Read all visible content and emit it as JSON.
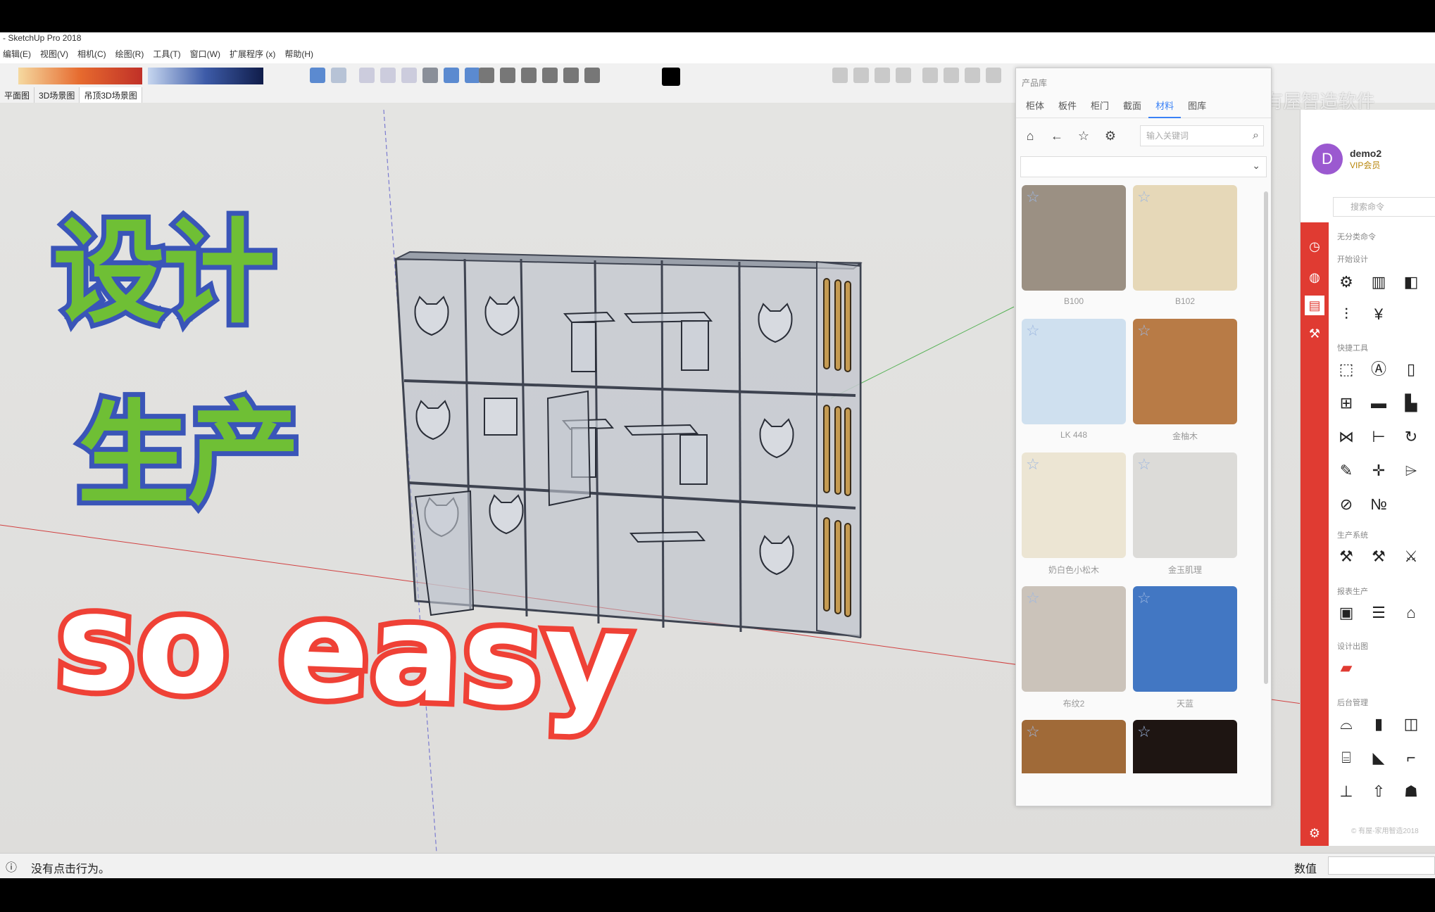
{
  "window": {
    "title": "- SketchUp Pro 2018"
  },
  "menu": [
    "编辑(E)",
    "视图(V)",
    "相机(C)",
    "绘图(R)",
    "工具(T)",
    "窗口(W)",
    "扩展程序 (x)",
    "帮助(H)"
  ],
  "scene_tabs": [
    "平面图",
    "3D场景图",
    "吊顶3D场景图"
  ],
  "overlay": {
    "line1": "设计",
    "line2": "生产",
    "line3": "so easy"
  },
  "watermark": "@有屋智造软件",
  "library": {
    "title": "产品库",
    "tabs": [
      "柜体",
      "板件",
      "柜门",
      "截面",
      "材料",
      "图库"
    ],
    "active_tab": "材料",
    "search_placeholder": "输入关键词",
    "materials": [
      {
        "name": "B100",
        "color": "#9b9083"
      },
      {
        "name": "B102",
        "color": "#e6d8b8"
      },
      {
        "name": "LK 448",
        "color": "#cfe0ef"
      },
      {
        "name": "金柚木",
        "color": "#b87b46"
      },
      {
        "name": "奶白色小松木",
        "color": "#ece5d3"
      },
      {
        "name": "金玉肌理",
        "color": "#dcdbd8"
      },
      {
        "name": "布纹2",
        "color": "#cbc3ba"
      },
      {
        "name": "天蓝",
        "color": "#4277c3"
      },
      {
        "name": "",
        "color": "#a06a38"
      },
      {
        "name": "",
        "color": "#1e1512"
      }
    ]
  },
  "plugin": {
    "user_initial": "D",
    "user_name": "demo2",
    "vip": "VIP会员",
    "search_placeholder": "搜索命令",
    "sections": {
      "s0": "无分类命令",
      "s1": "开始设计",
      "s2": "快捷工具",
      "s3": "生产系统",
      "s4": "报表生产",
      "s5": "设计出图",
      "s6": "后台管理"
    },
    "copyright": "© 有屋-家用智造2018"
  },
  "status": {
    "message": "没有点击行为。",
    "measure_label": "数值"
  },
  "colors": {
    "accent_red": "#e03b32",
    "text_green": "#6fbf35",
    "text_blue_outline": "#3a55b8",
    "easy_red": "#ef4136"
  }
}
